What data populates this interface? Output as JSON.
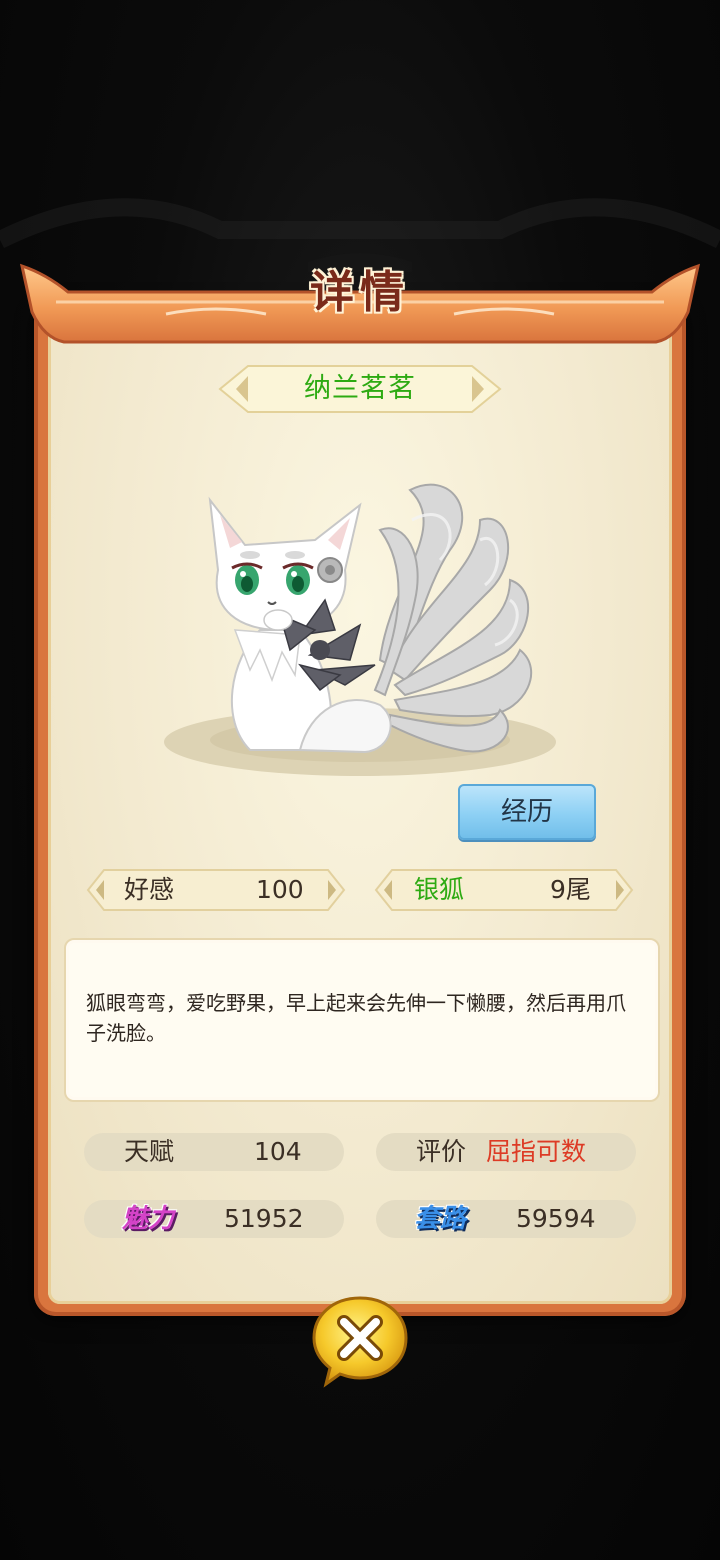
{
  "dialog": {
    "title": "详情",
    "pet_name": "纳兰茗茗",
    "experience_button": "经历",
    "affection": {
      "label": "好感",
      "value": "100"
    },
    "species": {
      "label": "银狐",
      "value": "9尾"
    },
    "description": "狐眼弯弯，爱吃野果，早上起来会先伸一下懒腰，然后再用爪子洗脸。",
    "talent": {
      "label": "天赋",
      "value": "104"
    },
    "rating": {
      "label": "评价",
      "value": "屈指可数"
    },
    "charm": {
      "label": "魅力",
      "value": "51952"
    },
    "tactics": {
      "label": "套路",
      "value": "59594"
    }
  },
  "colors": {
    "name_green": "#2daa12",
    "rating_red": "#dd3b25",
    "charm_pink": "#d443c7",
    "tactics_blue": "#3a8fe8",
    "frame_orange": "#d9753e"
  },
  "icons": [
    "close-icon"
  ]
}
